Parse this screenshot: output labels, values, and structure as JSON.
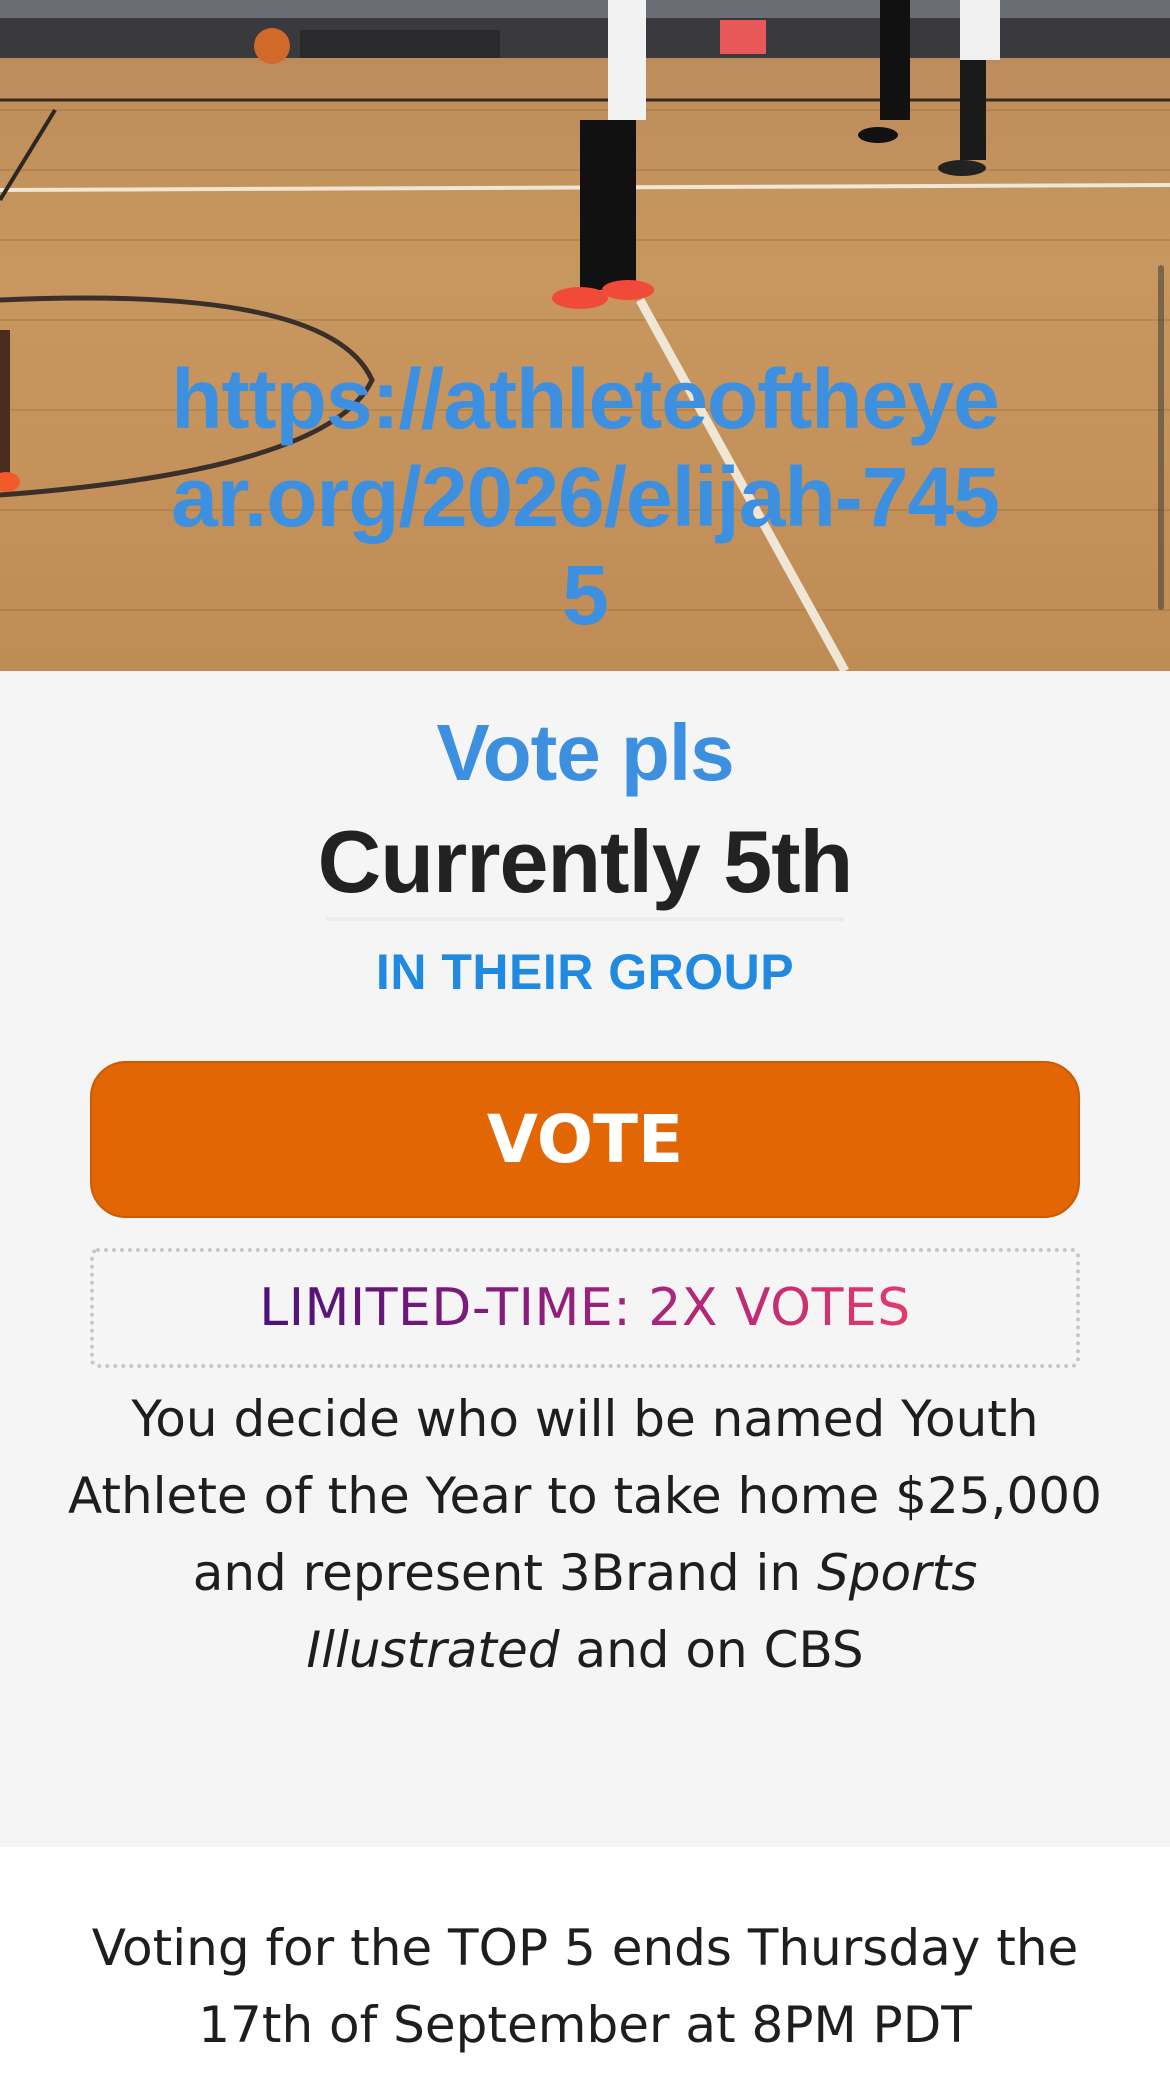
{
  "hero": {
    "link_text": "https://athleteoftheyear.org/2026/elijah-7455"
  },
  "card": {
    "headline": "Vote pls",
    "rank_text": "Currently 5th",
    "rank_context": "IN THEIR GROUP",
    "vote_button_label": "VOTE",
    "promo_text": "LIMITED-TIME: 2X VOTES",
    "description_part1": "You decide who will be named Youth Athlete of the Year to take home $25,000 and represent 3Brand in",
    "description_magazine": "Sports Illustrated",
    "description_part2": "and on CBS"
  },
  "footer": {
    "deadline_text": "Voting for the TOP 5 ends Thursday the 17th of September at 8PM PDT"
  },
  "colors": {
    "accent_blue": "#3d8fe0",
    "vote_orange": "#e36605",
    "promo_gradient_start": "#4a1278",
    "promo_gradient_end": "#e43a6a"
  }
}
